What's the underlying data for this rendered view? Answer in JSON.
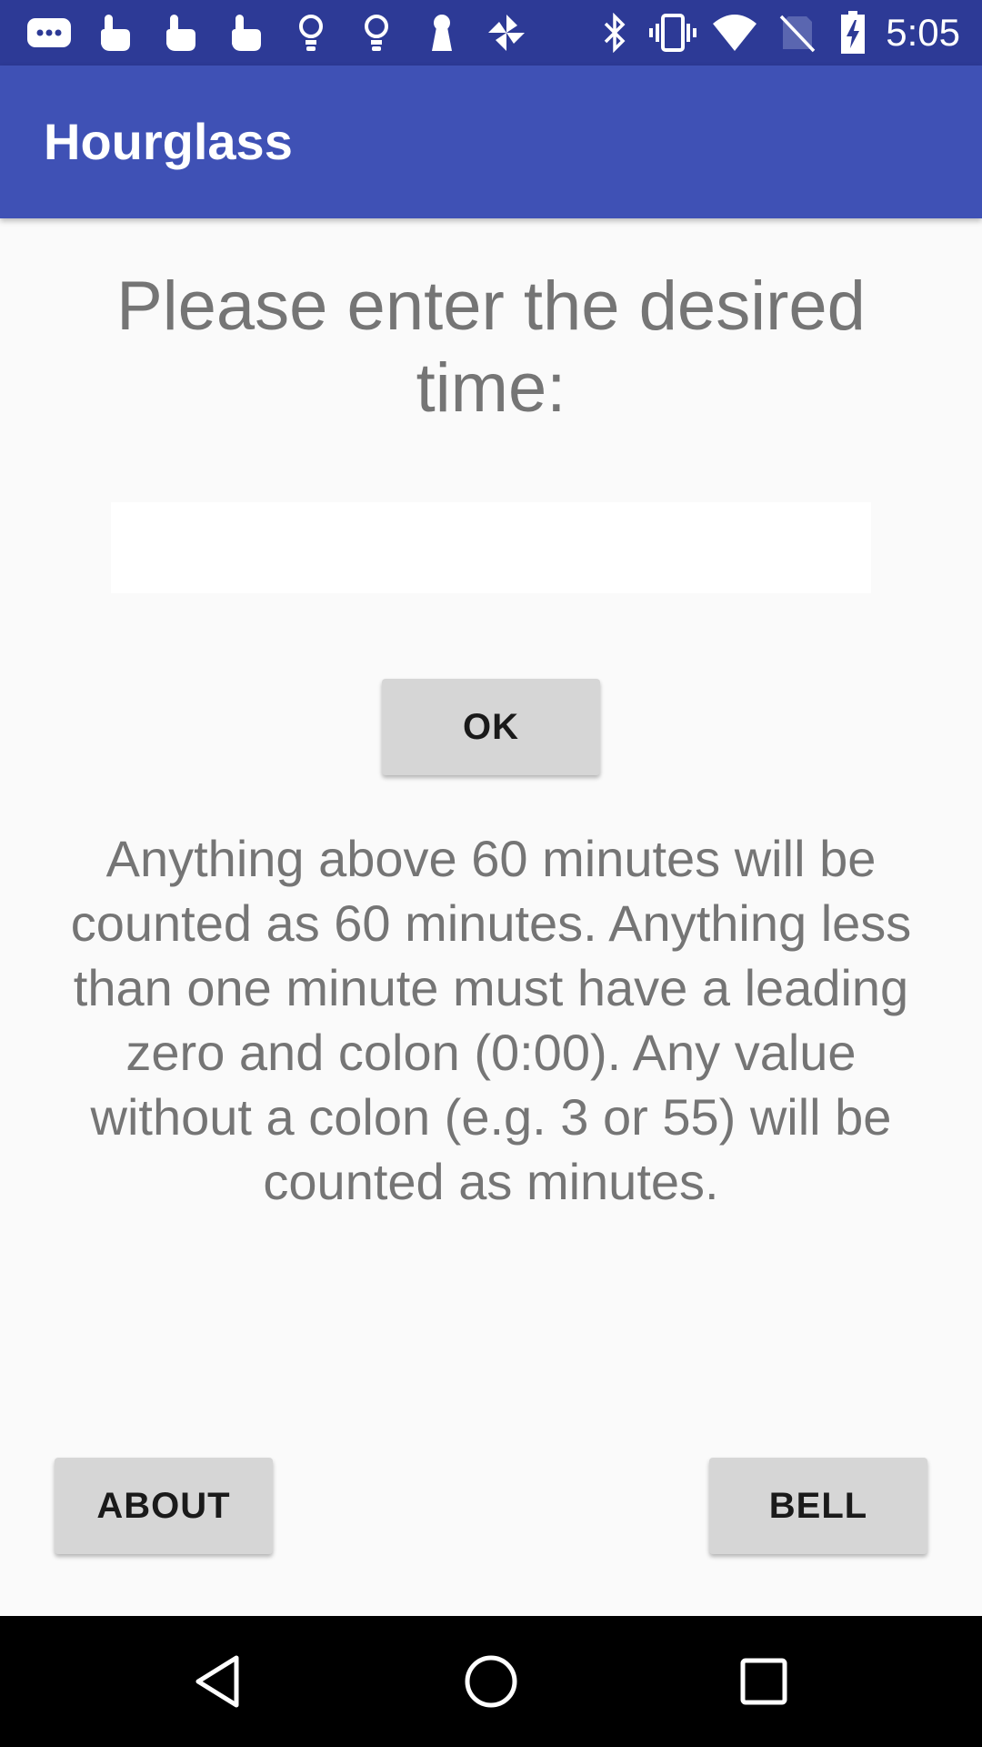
{
  "status_bar": {
    "time": "5:05",
    "icons": [
      "messaging-icon",
      "touch-icon",
      "touch-icon",
      "touch-icon",
      "lightbulb-icon",
      "lightbulb-icon",
      "keyhole-icon",
      "pinwheel-icon",
      "bluetooth-icon",
      "vibrate-icon",
      "wifi-icon",
      "no-sim-icon",
      "battery-charging-icon"
    ]
  },
  "app_bar": {
    "title": "Hourglass"
  },
  "main": {
    "prompt": "Please enter the desired time:",
    "time_input": {
      "value": "",
      "placeholder": ""
    },
    "ok_label": "OK",
    "info": "Anything above 60 minutes will be counted as 60 minutes. Anything less than one minute must have a leading zero and colon (0:00). Any value without a colon (e.g. 3 or 55) will be counted as minutes."
  },
  "footer": {
    "about_label": "ABOUT",
    "bell_label": "BELL"
  },
  "nav_bar": {
    "icons": [
      "back-icon",
      "home-icon",
      "recents-icon"
    ]
  },
  "colors": {
    "status_bar": "#2d3a96",
    "app_bar": "#3f51b5",
    "background": "#fafafa",
    "button": "#d6d6d6",
    "text_gray": "#757575"
  }
}
